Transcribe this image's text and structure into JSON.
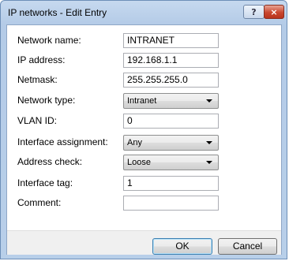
{
  "window": {
    "title": "IP networks - Edit Entry"
  },
  "titlebar_buttons": {
    "help": "?",
    "close": "×"
  },
  "form": {
    "network_name": {
      "label": "Network name:",
      "value": "INTRANET"
    },
    "ip_address": {
      "label": "IP address:",
      "value": "192.168.1.1"
    },
    "netmask": {
      "label": "Netmask:",
      "value": "255.255.255.0"
    },
    "network_type": {
      "label": "Network type:",
      "value": "Intranet"
    },
    "vlan_id": {
      "label": "VLAN ID:",
      "value": "0"
    },
    "interface_assignment": {
      "label": "Interface assignment:",
      "value": "Any"
    },
    "address_check": {
      "label": "Address check:",
      "value": "Loose"
    },
    "interface_tag": {
      "label": "Interface tag:",
      "value": "1"
    },
    "comment": {
      "label": "Comment:",
      "value": ""
    }
  },
  "buttons": {
    "ok": "OK",
    "cancel": "Cancel"
  },
  "icons": [
    "help-icon",
    "close-icon",
    "chevron-down-icon"
  ]
}
